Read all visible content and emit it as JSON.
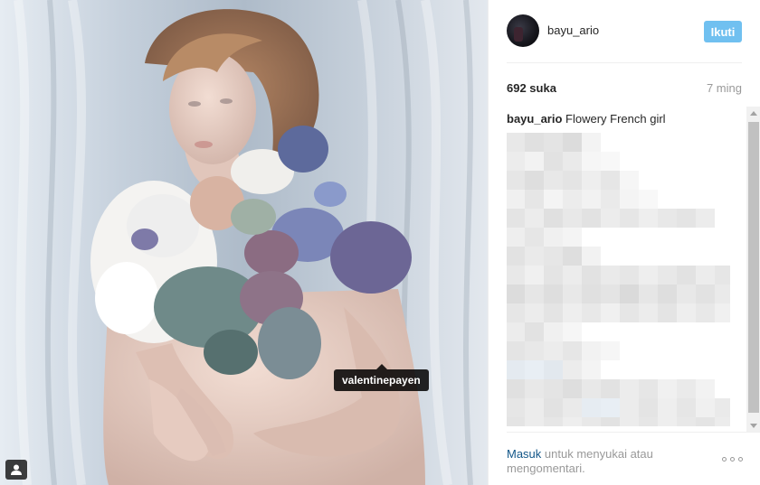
{
  "post": {
    "image_alt": "Woman wearing a collar of flowers",
    "people_tag": "valentinepayen"
  },
  "header": {
    "username": "bayu_ario",
    "follow_label": "Ikuti"
  },
  "stats": {
    "likes": "692 suka",
    "time_ago": "7 ming"
  },
  "caption": {
    "username": "bayu_ario",
    "text": "Flowery French girl"
  },
  "footer": {
    "login_link": "Masuk",
    "login_text": " untuk menyukai atau mengomentari."
  },
  "colors": {
    "follow_button": "#70c0f0",
    "link": "#125688",
    "muted_text": "#999999"
  },
  "icons": {
    "tag_button": "user-tag-icon",
    "more": "more-options-icon"
  }
}
